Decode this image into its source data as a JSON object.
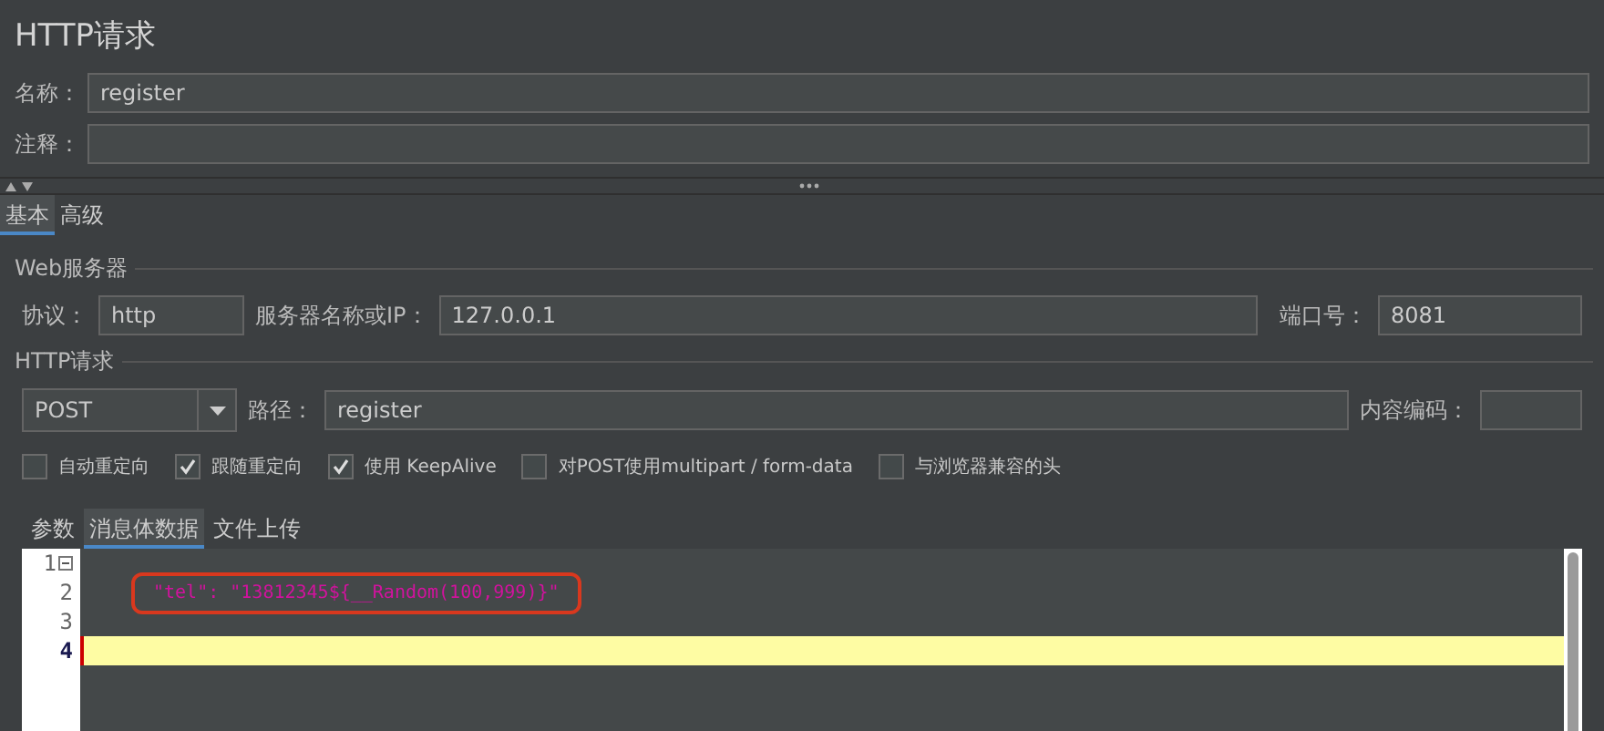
{
  "title": "HTTP请求",
  "name_field": {
    "label": "名称：",
    "value": "register"
  },
  "comment_field": {
    "label": "注释："
  },
  "tabs": [
    {
      "label": "基本",
      "selected": true
    },
    {
      "label": "高级",
      "selected": false
    }
  ],
  "web_server": {
    "title": "Web服务器",
    "protocol": {
      "label": "协议：",
      "value": "http"
    },
    "server": {
      "label": "服务器名称或IP：",
      "value": "127.0.0.1"
    },
    "port": {
      "label": "端口号：",
      "value": "8081"
    }
  },
  "http_request": {
    "title": "HTTP请求",
    "method": "POST",
    "path": {
      "label": "路径：",
      "value": "register"
    },
    "encoding": {
      "label": "内容编码："
    },
    "options": [
      {
        "label": "自动重定向",
        "checked": false
      },
      {
        "label": "跟随重定向",
        "checked": true
      },
      {
        "label": "使用 KeepAlive",
        "checked": true
      },
      {
        "label": "对POST使用multipart / form-data",
        "checked": false
      },
      {
        "label": "与浏览器兼容的头",
        "checked": false
      }
    ]
  },
  "body_tabs": [
    {
      "label": "参数",
      "selected": false
    },
    {
      "label": "消息体数据",
      "selected": true
    },
    {
      "label": "文件上传",
      "selected": false
    }
  ],
  "editor": {
    "lines": [
      {
        "number": "1",
        "current": false,
        "foldable": true
      },
      {
        "number": "2",
        "current": false,
        "foldable": false,
        "text": "\"tel\": \"13812345${__Random(100,999)}\"",
        "highlighted": true
      },
      {
        "number": "3",
        "current": false,
        "foldable": false
      },
      {
        "number": "4",
        "current": true,
        "foldable": false
      }
    ]
  }
}
